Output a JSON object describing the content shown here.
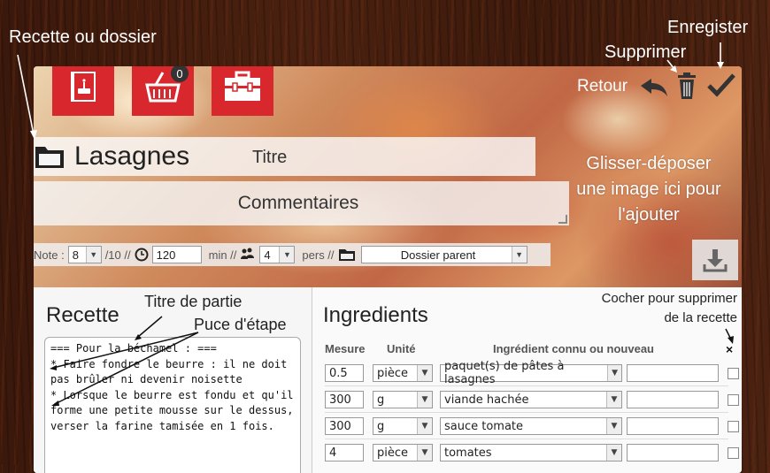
{
  "annotations": {
    "recipe_or_folder": "Recette ou dossier",
    "save": "Enregister",
    "delete": "Supprimer",
    "back": "Retour",
    "title_hint": "Titre",
    "drop_hint": "Glisser-déposer une image ici pour l'ajouter",
    "part_title": "Titre de partie",
    "step_bullet": "Puce d'étape",
    "check_to_delete": "Cocher pour supprimer de la recette"
  },
  "tiles": {
    "cart_badge": "0"
  },
  "recipe": {
    "title": "Lasagnes",
    "comment_placeholder": "Commentaires",
    "note_label": "Note :",
    "note_value": "8",
    "note_max": "/10 //",
    "time_value": "120",
    "time_unit": "min //",
    "persons_value": "4",
    "persons_unit": "pers //",
    "parent_folder": "Dossier parent"
  },
  "left": {
    "heading": "Recette",
    "text": "=== Pour la béchamel : ===\n* Faire fondre le beurre : il ne doit pas brûler ni devenir noisette\n* Lorsque le beurre est fondu et qu'il forme une petite mousse sur le dessus, verser la farine tamisée en 1 fois."
  },
  "right": {
    "heading": "Ingredients",
    "col_measure": "Mesure",
    "col_unit": "Unité",
    "col_ingredient": "Ingrédient connu ou nouveau",
    "col_delete": "×",
    "rows": [
      {
        "measure": "0.5",
        "unit": "pièce",
        "ingredient": "paquet(s) de pâtes à lasagnes",
        "note": ""
      },
      {
        "measure": "300",
        "unit": "g",
        "ingredient": "viande hachée",
        "note": ""
      },
      {
        "measure": "300",
        "unit": "g",
        "ingredient": "sauce tomate",
        "note": ""
      },
      {
        "measure": "4",
        "unit": "pièce",
        "ingredient": "tomates",
        "note": ""
      }
    ]
  },
  "colors": {
    "tile_red": "#d9272e",
    "wood": "#3b1a0c"
  }
}
